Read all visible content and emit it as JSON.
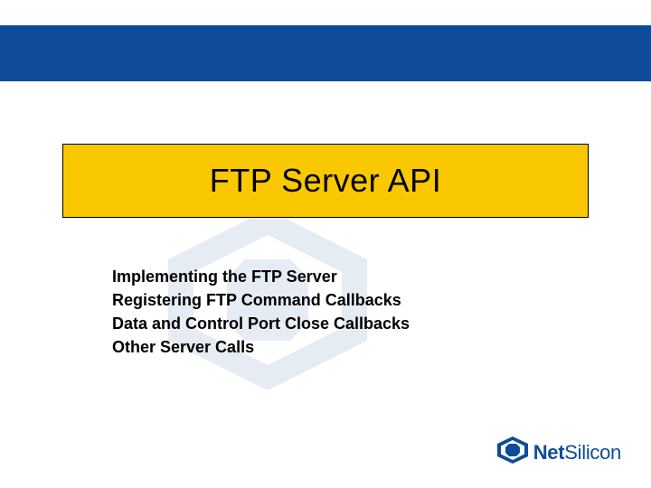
{
  "slide": {
    "title": "FTP Server API",
    "bullets": [
      "Implementing the FTP Server",
      "Registering FTP Command Callbacks",
      "Data and Control Port Close Callbacks",
      "Other Server Calls"
    ],
    "brand": {
      "name_bold": "Net",
      "name_thin": "Silicon"
    },
    "colors": {
      "header_bar": "#0e4c9a",
      "title_bg": "#f9c800",
      "brand": "#0e4c9a"
    }
  }
}
